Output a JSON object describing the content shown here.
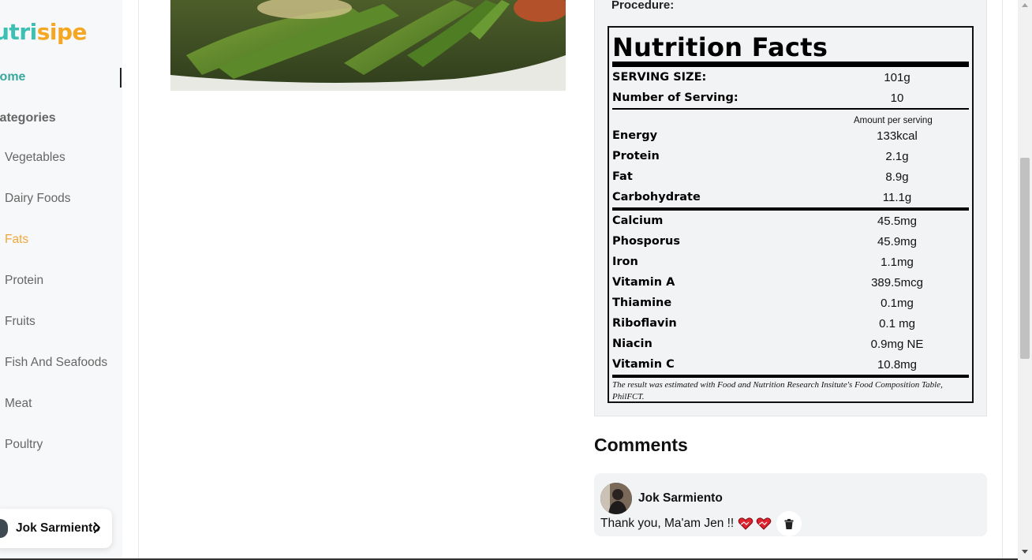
{
  "app": {
    "logo_part1": "utri",
    "logo_part2": "sipe"
  },
  "sidebar": {
    "home_label": "Home",
    "categories_label": "Categories",
    "items": [
      {
        "label": "Vegetables",
        "active": false
      },
      {
        "label": "Dairy Foods",
        "active": false
      },
      {
        "label": "Fats",
        "active": true
      },
      {
        "label": "Protein",
        "active": false
      },
      {
        "label": "Fruits",
        "active": false
      },
      {
        "label": "Fish And Seafoods",
        "active": false
      },
      {
        "label": "Meat",
        "active": false
      },
      {
        "label": "Poultry",
        "active": false
      }
    ],
    "user_name": "Jok Sarmiento"
  },
  "procedure": {
    "title": "Procedure:"
  },
  "nutrition": {
    "title": "Nutrition Facts",
    "serving_size_label": "SERVING SIZE:",
    "serving_size_value": "101g",
    "servings_label": "Number of Serving:",
    "servings_value": "10",
    "amount_per_serving": "Amount per serving",
    "macros": [
      {
        "label": "Energy",
        "value": "133kcal"
      },
      {
        "label": "Protein",
        "value": "2.1g"
      },
      {
        "label": "Fat",
        "value": "8.9g"
      },
      {
        "label": "Carbohydrate",
        "value": "11.1g"
      }
    ],
    "micros": [
      {
        "label": "Calcium",
        "value": "45.5mg"
      },
      {
        "label": "Phosporus",
        "value": "45.9mg"
      },
      {
        "label": "Iron",
        "value": "1.1mg"
      },
      {
        "label": "Vitamin A",
        "value": "389.5mcg"
      },
      {
        "label": "Thiamine",
        "value": "0.1mg"
      },
      {
        "label": "Riboflavin",
        "value": "0.1 mg"
      },
      {
        "label": "Niacin",
        "value": "0.9mg NE"
      },
      {
        "label": "Vitamin C",
        "value": "10.8mg"
      }
    ],
    "note": "The result was estimated with Food and Nutrition Research Insitute's Food Composition Table, PhilFCT."
  },
  "comments": {
    "title": "Comments",
    "items": [
      {
        "author": "Jok Sarmiento",
        "text": "Thank you, Ma'am Jen !!"
      }
    ]
  },
  "colors": {
    "brand_teal": "#3dbfb3",
    "brand_orange": "#f5a623",
    "active_item": "#f0a73a"
  }
}
